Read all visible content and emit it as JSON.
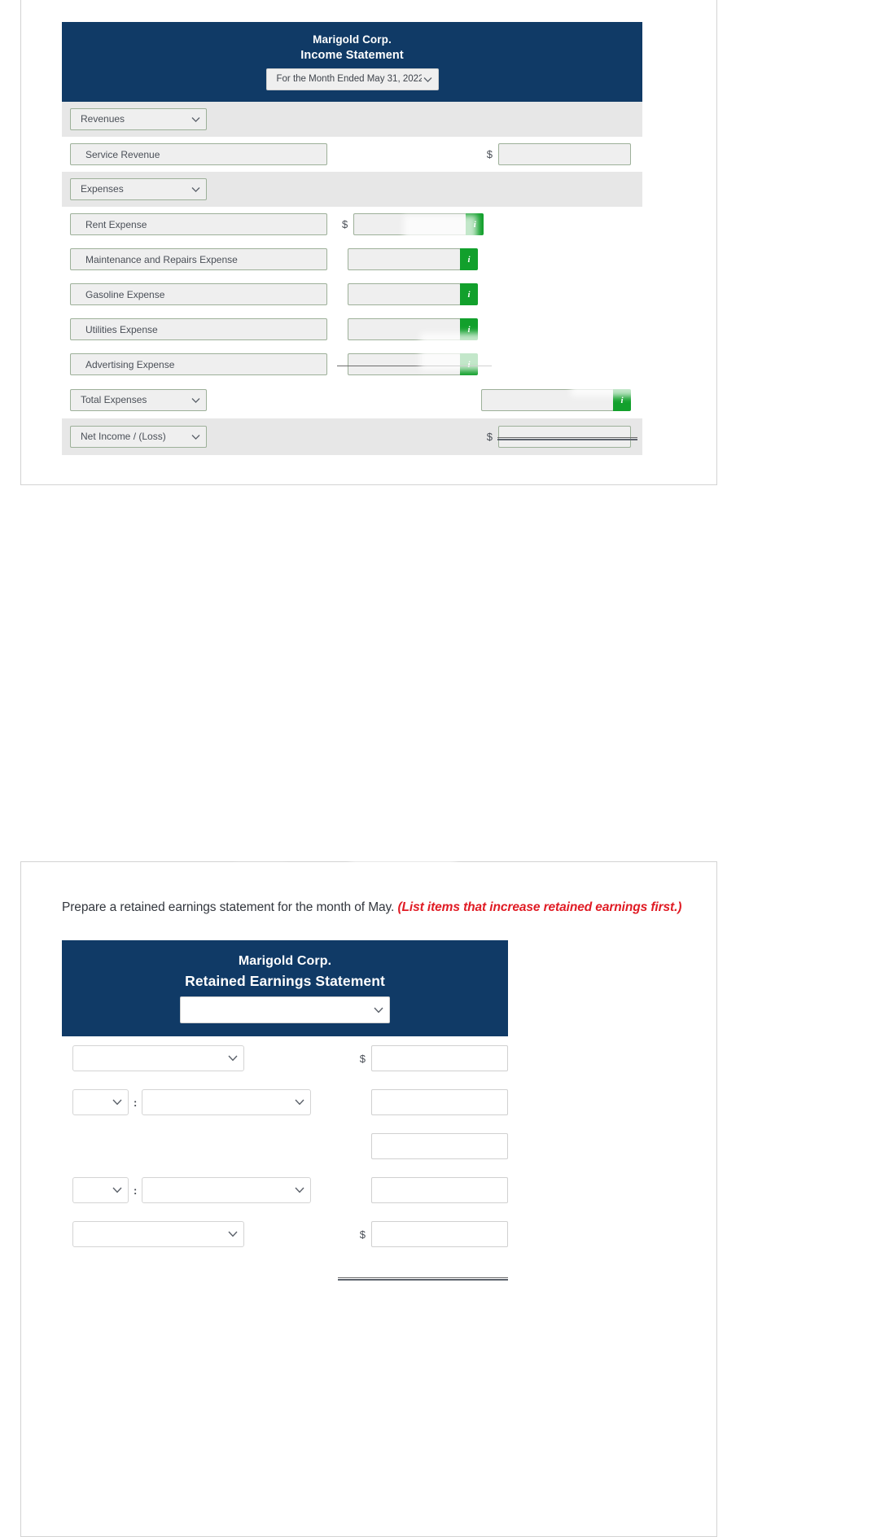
{
  "income_statement": {
    "company": "Marigold Corp.",
    "title": "Income Statement",
    "period_select": "For the Month Ended May 31, 2022",
    "sections": [
      {
        "name": "revenues_header",
        "label": "Revenues"
      },
      {
        "name": "expenses_header",
        "label": "Expenses"
      },
      {
        "name": "total_expenses_header",
        "label": "Total Expenses"
      },
      {
        "name": "net_income_header",
        "label": "Net Income / (Loss)"
      }
    ],
    "revenue_lines": [
      {
        "label": "Service Revenue",
        "currency": "$",
        "amount": ""
      }
    ],
    "expense_lines": [
      {
        "label": "Rent Expense",
        "currency": "$",
        "amount": "",
        "info": "i"
      },
      {
        "label": "Maintenance and Repairs Expense",
        "currency": "",
        "amount": "",
        "info": "i"
      },
      {
        "label": "Gasoline Expense",
        "currency": "",
        "amount": "",
        "info": "i"
      },
      {
        "label": "Utilities Expense",
        "currency": "",
        "amount": "",
        "info": "i"
      },
      {
        "label": "Advertising Expense",
        "currency": "",
        "amount": "",
        "info": "i"
      }
    ],
    "total_expenses": {
      "amount": "",
      "info": "i"
    },
    "net_income": {
      "currency": "$",
      "amount": ""
    }
  },
  "retained_earnings": {
    "instruction_text": "Prepare a retained earnings statement for the month of May. ",
    "instruction_hint": "(List items that increase retained earnings first.)",
    "company": "Marigold Corp.",
    "title": "Retained Earnings Statement",
    "period_select": "",
    "rows": [
      {
        "name": "row-1",
        "type": "single-select",
        "select": "",
        "currency": "$",
        "amount": ""
      },
      {
        "name": "row-2",
        "type": "dual-select",
        "select_a": "",
        "separator": ":",
        "select_b": "",
        "currency": "",
        "amount": ""
      },
      {
        "name": "row-3",
        "type": "amount-only",
        "currency": "",
        "amount": ""
      },
      {
        "name": "row-4",
        "type": "dual-select",
        "select_a": "",
        "separator": ":",
        "select_b": "",
        "currency": "",
        "amount": ""
      },
      {
        "name": "row-5",
        "type": "single-select",
        "select": "",
        "currency": "$",
        "amount": ""
      }
    ]
  },
  "icons": {
    "chevron_down": "chevron-down-icon",
    "info": "info-icon"
  },
  "colors": {
    "header_navy": "#103A66",
    "info_green": "#12a02c",
    "hint_red": "#e01b24",
    "field_grey": "#efefef",
    "field_border_green": "#9db099"
  }
}
